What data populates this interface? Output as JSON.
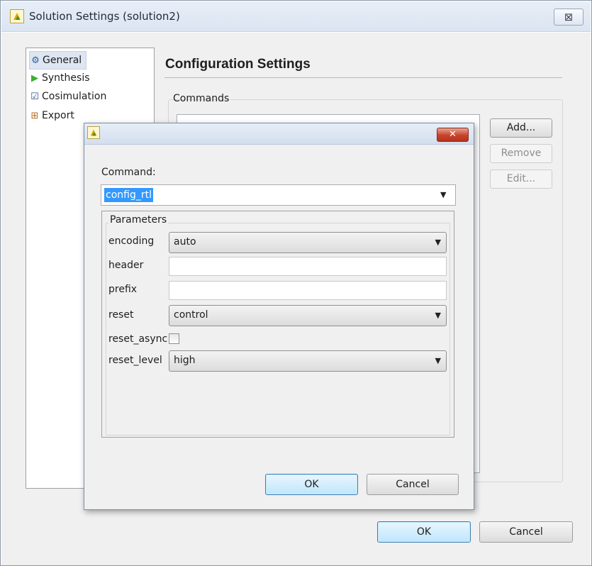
{
  "outer_window": {
    "title": "Solution Settings (solution2)",
    "close_glyph": "⊠"
  },
  "nav": {
    "items": [
      {
        "label": "General",
        "icon": "gear-icon"
      },
      {
        "label": "Synthesis",
        "icon": "play-triangle-icon"
      },
      {
        "label": "Cosimulation",
        "icon": "checkbox-icon"
      },
      {
        "label": "Export",
        "icon": "grid-box-icon"
      }
    ]
  },
  "config": {
    "title": "Configuration Settings",
    "commands_label": "Commands",
    "add_label": "Add...",
    "remove_label": "Remove",
    "edit_label": "Edit..."
  },
  "outer_buttons": {
    "ok": "OK",
    "cancel": "Cancel"
  },
  "dialog": {
    "close_glyph": "✕",
    "command_label": "Command:",
    "command_value": "config_rtl",
    "parameters_label": "Parameters",
    "params": {
      "encoding": {
        "label": "encoding",
        "value": "auto"
      },
      "header": {
        "label": "header",
        "value": ""
      },
      "prefix": {
        "label": "prefix",
        "value": ""
      },
      "reset": {
        "label": "reset",
        "value": "control"
      },
      "reset_async": {
        "label": "reset_async",
        "checked": false
      },
      "reset_level": {
        "label": "reset_level",
        "value": "high"
      }
    },
    "ok": "OK",
    "cancel": "Cancel"
  },
  "colors": {
    "selection": "#3399ff",
    "close_red": "#c7432b",
    "synthesis_green": "#3cae2f",
    "export_orange": "#b76b1f"
  }
}
